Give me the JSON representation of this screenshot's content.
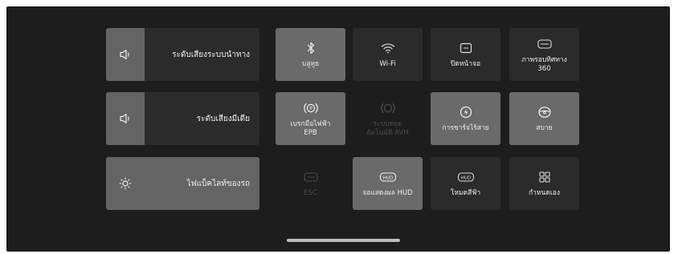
{
  "sliders": {
    "nav_volume": {
      "label": "ระดับเสียงระบบนำทาง",
      "level": 0.2,
      "icon": "speaker-icon"
    },
    "media_volume": {
      "label": "ระดับเสียงมีเดีย",
      "level": 0.2,
      "icon": "speaker-icon"
    },
    "ambient_light": {
      "label": "ไฟแบ็คไลท์ของรถ",
      "level": 1.0,
      "icon": "brightness-icon"
    }
  },
  "tiles": {
    "bluetooth": {
      "label": "บลูทูธ",
      "state": "on",
      "icon": "bluetooth-icon"
    },
    "wifi": {
      "label": "Wi-Fi",
      "state": "off",
      "icon": "wifi-icon"
    },
    "screen_off": {
      "label": "ปิดหน้าจอ",
      "state": "off",
      "icon": "screen-off-icon"
    },
    "view360": {
      "label": "ภาพรอบทิศทาง",
      "label2": "360",
      "state": "off",
      "icon": "camera-360-icon"
    },
    "epb": {
      "label": "เบรกมือไฟฟ้า",
      "label2": "EPB",
      "state": "on",
      "icon": "parking-brake-icon"
    },
    "avh": {
      "label": "ระบบหยุด",
      "label2": "อัตโนมัติ AVH",
      "state": "disabled",
      "icon": "auto-hold-icon"
    },
    "wireless_charging": {
      "label": "การชาร์จไร้สาย",
      "state": "on",
      "icon": "wireless-charging-icon"
    },
    "comfort": {
      "label": "สบาย",
      "state": "on",
      "icon": "steering-icon"
    },
    "esc": {
      "label": "ESC",
      "state": "disabled",
      "icon": "esc-icon"
    },
    "hud_display": {
      "label": "จอแสดงผล HUD",
      "state": "on",
      "icon": "hud-icon"
    },
    "sky_mode": {
      "label": "โหมดสีฟ้า",
      "state": "off",
      "icon": "hud-icon"
    },
    "customize": {
      "label": "กำหนดเอง",
      "state": "off",
      "icon": "grid-icon"
    }
  }
}
